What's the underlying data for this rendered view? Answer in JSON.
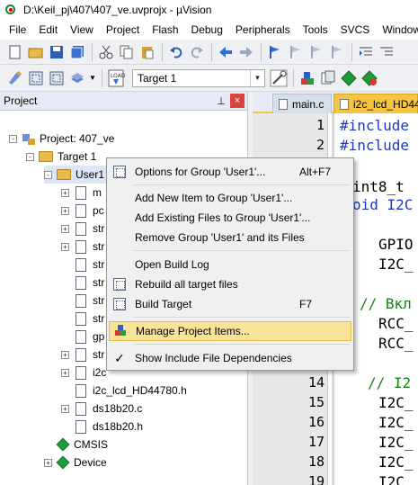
{
  "window": {
    "title": "D:\\Keil_pj\\407\\407_ve.uvprojx - µVision"
  },
  "menu": [
    "File",
    "Edit",
    "View",
    "Project",
    "Flash",
    "Debug",
    "Peripherals",
    "Tools",
    "SVCS",
    "Window"
  ],
  "toolbar": {
    "target_value": "Target 1"
  },
  "project_panel": {
    "title": "Project",
    "pin_glyph": "⊥",
    "close_glyph": "×",
    "tree": [
      {
        "label": "Project: 407_ve",
        "type": "project",
        "exp": "-"
      },
      {
        "label": "Target 1",
        "type": "folder",
        "exp": "-"
      },
      {
        "label": "User1",
        "type": "folder",
        "exp": "-"
      },
      {
        "label": "m",
        "type": "file",
        "exp": "+"
      },
      {
        "label": "pc",
        "type": "file",
        "exp": "+"
      },
      {
        "label": "str",
        "type": "file",
        "exp": "+"
      },
      {
        "label": "str",
        "type": "file",
        "exp": "+"
      },
      {
        "label": "str",
        "type": "file",
        "exp": ""
      },
      {
        "label": "str",
        "type": "file",
        "exp": ""
      },
      {
        "label": "str",
        "type": "file",
        "exp": ""
      },
      {
        "label": "str",
        "type": "file",
        "exp": ""
      },
      {
        "label": "gp",
        "type": "file",
        "exp": ""
      },
      {
        "label": "str",
        "type": "file",
        "exp": "+"
      },
      {
        "label": "i2c",
        "type": "file",
        "exp": "+"
      },
      {
        "label": "i2c_lcd_HD44780.h",
        "type": "file",
        "exp": ""
      },
      {
        "label": "ds18b20.c",
        "type": "file",
        "exp": "+"
      },
      {
        "label": "ds18b20.h",
        "type": "file",
        "exp": ""
      },
      {
        "label": "CMSIS",
        "type": "gem",
        "exp": ""
      },
      {
        "label": "Device",
        "type": "gem",
        "exp": "+"
      }
    ]
  },
  "editor": {
    "tabs": [
      {
        "label": "main.c"
      },
      {
        "label": "i2c_lcd_HD44"
      }
    ],
    "line_numbers": [
      "1",
      "2",
      "14",
      "15",
      "16",
      "17",
      "18",
      "19"
    ],
    "code_lines": [
      {
        "text": "#include",
        "color": "blue"
      },
      {
        "text": "#include",
        "color": "blue"
      },
      {
        "text": "int8_t",
        "color": "black"
      },
      {
        "text": "oid I2C",
        "color": "blue"
      },
      {
        "text": "GPIO",
        "color": "black"
      },
      {
        "text": "I2C_",
        "color": "black"
      },
      {
        "text": "// Вкл",
        "color": "green"
      },
      {
        "text": "RCC_",
        "color": "black"
      },
      {
        "text": "RCC_",
        "color": "black"
      },
      {
        "text": "// I2",
        "color": "green"
      },
      {
        "text": "I2C_",
        "color": "black"
      },
      {
        "text": "I2C_",
        "color": "black"
      },
      {
        "text": "I2C_",
        "color": "black"
      },
      {
        "text": "I2C_",
        "color": "black"
      },
      {
        "text": "I2C_",
        "color": "black"
      }
    ]
  },
  "context_menu": {
    "items": [
      {
        "label": "Options for Group 'User1'...",
        "shortcut": "Alt+F7",
        "icon": "options-icon"
      },
      {
        "label": "Add New  Item to Group 'User1'...",
        "shortcut": "",
        "icon": ""
      },
      {
        "label": "Add Existing Files to Group 'User1'...",
        "shortcut": "",
        "icon": ""
      },
      {
        "label": "Remove Group 'User1' and its Files",
        "shortcut": "",
        "icon": ""
      },
      {
        "label": "Open Build Log",
        "shortcut": "",
        "icon": ""
      },
      {
        "label": "Rebuild all target files",
        "shortcut": "",
        "icon": "rebuild-icon"
      },
      {
        "label": "Build Target",
        "shortcut": "F7",
        "icon": "build-icon"
      },
      {
        "label": "Manage Project Items...",
        "shortcut": "",
        "icon": "manage-items-icon"
      },
      {
        "label": "Show Include File Dependencies",
        "shortcut": "",
        "icon": "checkmark-icon"
      }
    ],
    "check_glyph": "✓"
  },
  "colors": {
    "menu_highlight": "#f8e39a",
    "active_tab": "#f5c542",
    "close_button": "#d8443c"
  }
}
